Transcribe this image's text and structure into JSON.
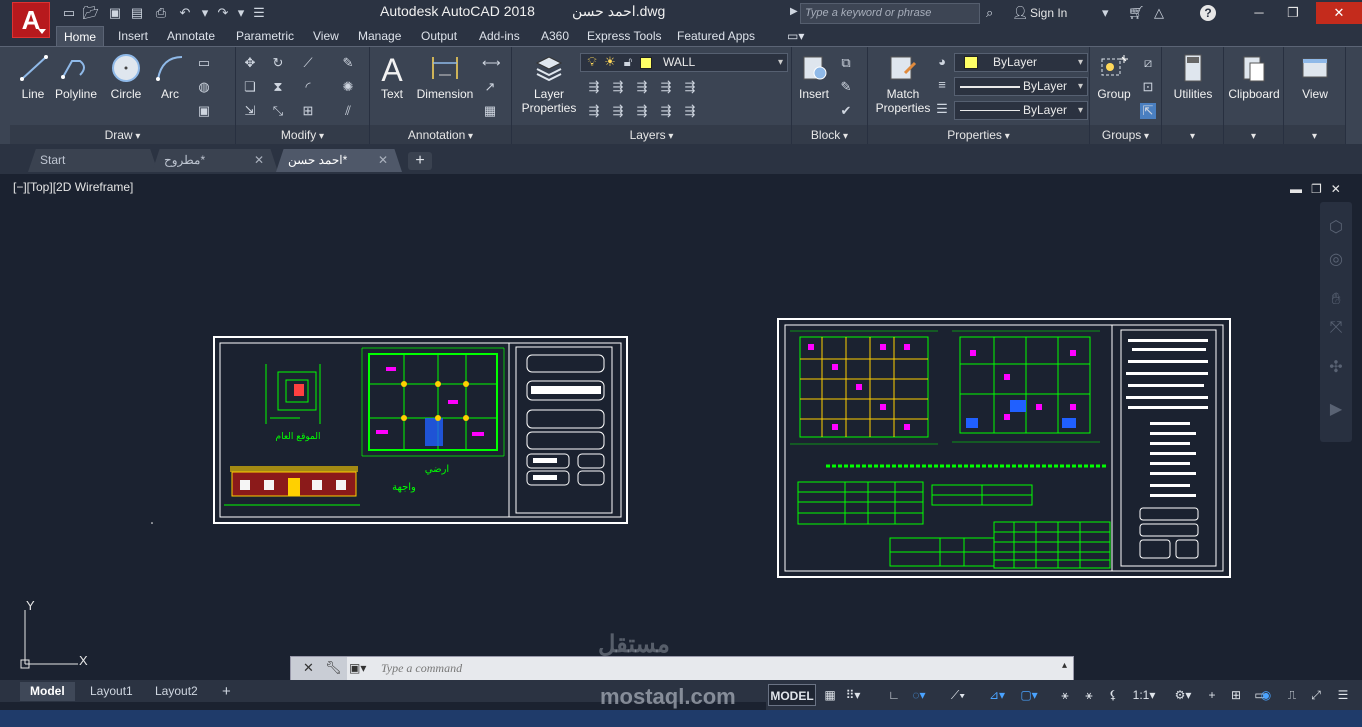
{
  "titlebar": {
    "app_title": "Autodesk AutoCAD 2018",
    "file_title": "احمد حسن.dwg",
    "search_placeholder": "Type a keyword or phrase",
    "sign_in": "Sign In",
    "help": "?"
  },
  "ribbon_tabs": [
    "Home",
    "Insert",
    "Annotate",
    "Parametric",
    "View",
    "Manage",
    "Output",
    "Add-ins",
    "A360",
    "Express Tools",
    "Featured Apps"
  ],
  "ribbon": {
    "draw": {
      "title": "Draw",
      "line": "Line",
      "polyline": "Polyline",
      "circle": "Circle",
      "arc": "Arc"
    },
    "modify": {
      "title": "Modify"
    },
    "annotation": {
      "title": "Annotation",
      "text": "Text",
      "dimension": "Dimension"
    },
    "layers": {
      "title": "Layers",
      "layer_properties_1": "Layer",
      "layer_properties_2": "Properties",
      "current_layer": "WALL"
    },
    "block": {
      "title": "Block",
      "insert": "Insert"
    },
    "properties": {
      "title": "Properties",
      "match_1": "Match",
      "match_2": "Properties",
      "color": "ByLayer",
      "linetype": "ByLayer",
      "lineweight": "ByLayer"
    },
    "groups": {
      "title": "Groups",
      "group": "Group"
    },
    "utilities": "Utilities",
    "clipboard": "Clipboard",
    "view": "View"
  },
  "doc_tabs": [
    {
      "label": "Start"
    },
    {
      "label": "مطروح*"
    },
    {
      "label": "احمد حسن*"
    }
  ],
  "viewport": {
    "label": "[−][Top][2D Wireframe]",
    "ucs_y": "Y",
    "ucs_x": "X"
  },
  "drawing_left": {
    "site_label": "الموقع العام",
    "plan_label": "ارضي",
    "elevation_label": "واجهة"
  },
  "command": {
    "placeholder": "Type a command"
  },
  "layout_tabs": [
    "Model",
    "Layout1",
    "Layout2"
  ],
  "status": {
    "model": "MODEL",
    "scale": "1:1"
  },
  "watermark": "mostaql.com",
  "colors": {
    "accent_red": "#b7191d",
    "sheet_line": "#ffffff",
    "geometry_green": "#00ff00",
    "dim_magenta": "#ff00ff",
    "grid_yellow": "#ffd000",
    "layer_yellow": "#ffff66"
  }
}
